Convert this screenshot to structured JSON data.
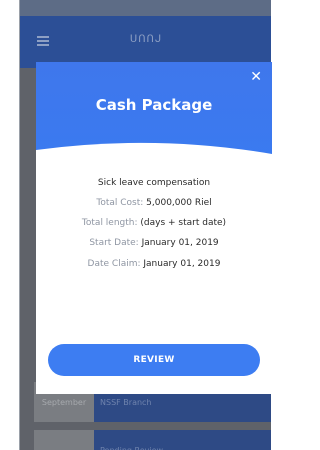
{
  "header": {
    "title": "ᑌᑎᑎᒍ"
  },
  "background": {
    "cards": [
      {
        "date": "September",
        "info": "NSSF Branch"
      },
      {
        "date": "",
        "info": "Pending Review"
      }
    ]
  },
  "modal": {
    "title": "Cash Package",
    "close_icon": "✕",
    "description": "Sick leave compensation",
    "total_cost_label": "Total Cost:",
    "total_cost_value": "5,000,000 Riel",
    "total_length_label": "Total length:",
    "total_length_value": "(days + start date)",
    "start_date_label": "Start Date:",
    "start_date_value": "January 01, 2019",
    "date_claim_label": "Date Claim:",
    "date_claim_value": "January 01, 2019",
    "review_button_label": "REVIEW"
  },
  "colors": {
    "primary": "#3d7df2",
    "header_dimmed": "#2c4f96",
    "label_gray": "#8f96a3"
  },
  "icons": {
    "menu": "hamburger-icon",
    "close": "close-icon"
  }
}
